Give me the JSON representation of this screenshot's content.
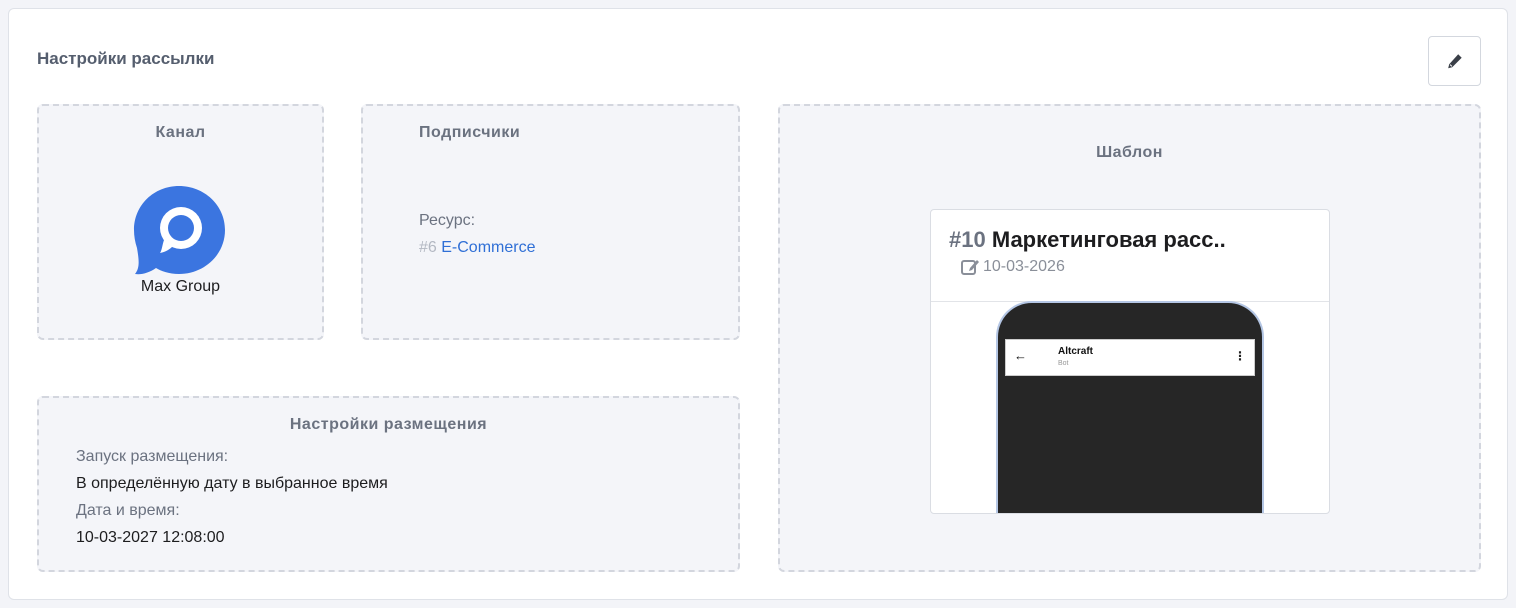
{
  "panel": {
    "title": "Настройки рассылки"
  },
  "channel": {
    "title": "Канал",
    "name": "Max Group",
    "icon": "max-messenger-logo-icon",
    "brand_color": "#3b75e0"
  },
  "subscribers": {
    "title": "Подписчики",
    "resource_label": "Ресурс:",
    "resource_id": "#6",
    "resource_name": "E-Commerce"
  },
  "placement": {
    "title": "Настройки размещения",
    "launch_label": "Запуск размещения:",
    "launch_value": "В определённую дату в выбранное время",
    "datetime_label": "Дата и время:",
    "datetime_value": "10-03-2027 12:08:00"
  },
  "template": {
    "title": "Шаблон",
    "number": "#10",
    "name": "Маркетинговая расс..",
    "date": "10-03-2026",
    "preview": {
      "bot_name": "Altcraft",
      "bot_sub": "Bot",
      "back": "←",
      "menu": "⋮"
    }
  }
}
